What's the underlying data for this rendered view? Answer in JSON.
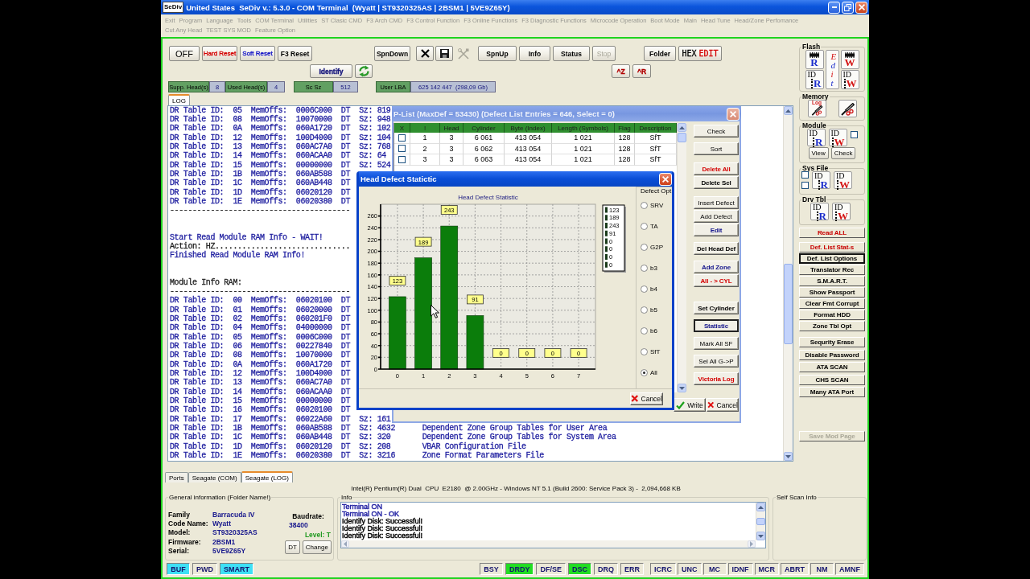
{
  "window": {
    "app_icon_text": "SeDiv",
    "title": "United States  SeDiv v.: 5.3.0 - COM Terminal  (Wyatt | ST9320325AS | 2BSM1 | 5VE9Z65Y)"
  },
  "menu": [
    [
      {
        "label": "Exit",
        "disabled": true
      },
      {
        "label": "Program",
        "disabled": true
      },
      {
        "label": "Language",
        "disabled": true
      },
      {
        "label": "Tools",
        "disabled": true
      },
      {
        "label": "COM Terminal",
        "disabled": true
      },
      {
        "label": "Utilities",
        "disabled": true
      },
      {
        "label": "ST Clasic CMD",
        "disabled": true
      },
      {
        "label": "F3 Arch CMD",
        "disabled": true
      },
      {
        "label": "F3 Control Function",
        "disabled": true
      },
      {
        "label": "F3 Online Functions",
        "disabled": true
      },
      {
        "label": "F3 Diagnostic Functions",
        "disabled": true
      },
      {
        "label": "Microcode Operation",
        "disabled": true
      },
      {
        "label": "Boot Mode",
        "disabled": true
      },
      {
        "label": "Main",
        "disabled": true
      },
      {
        "label": "Head Tune",
        "disabled": true
      },
      {
        "label": "Head/Zone Perfomance",
        "disabled": true
      }
    ],
    [
      {
        "label": "Cut Any Head",
        "disabled": true
      },
      {
        "label": "TEST SYS MOD",
        "disabled": true
      },
      {
        "label": "Feature Option",
        "disabled": true
      }
    ]
  ],
  "toolbar": {
    "row1": [
      [
        {
          "kind": "text",
          "label": "OFF",
          "bold": false,
          "disabled": false
        },
        {
          "kind": "text",
          "label": "Hard Reset",
          "color": "#d40000",
          "bold": false,
          "disabled": false
        },
        {
          "kind": "text",
          "label": "Soft Reset",
          "color": "#1818c8",
          "bold": false,
          "disabled": false
        },
        {
          "kind": "text",
          "label": "F3 Reset",
          "bold": true,
          "disabled": false
        }
      ],
      [
        {
          "kind": "text",
          "label": "SpnDown",
          "bold": true,
          "disabled": false
        }
      ],
      [
        {
          "kind": "icon",
          "disabled": false
        },
        {
          "kind": "icon",
          "disabled": false
        },
        {
          "kind": "icon",
          "disabled": true
        }
      ],
      [
        {
          "kind": "text",
          "label": "SpnUp",
          "bold": true,
          "disabled": false
        },
        {
          "kind": "text",
          "label": "Info",
          "bold": true,
          "disabled": false
        },
        {
          "kind": "text",
          "label": "Status",
          "bold": true,
          "disabled": false
        },
        {
          "kind": "text",
          "label": "Stop",
          "bold": false,
          "disabled": true
        }
      ],
      [
        {
          "kind": "text",
          "label": "Folder",
          "bold": true,
          "disabled": false
        },
        {
          "kind": "split",
          "parts": [
            {
              "text": "HEX",
              "color": "#000000"
            },
            {
              "text": "EDIT",
              "color": "#d40000"
            }
          ],
          "disabled": false
        }
      ]
    ],
    "row2": [
      [
        {
          "kind": "text",
          "label": "Identify",
          "bold": true,
          "color": "#12127a",
          "disabled": false
        },
        {
          "kind": "icon",
          "disabled": false
        }
      ],
      [
        {
          "kind": "text",
          "label": "^Z",
          "bold": true,
          "color": "#b00000",
          "disabled": false
        },
        {
          "kind": "text",
          "label": "^R",
          "bold": true,
          "color": "#b00000",
          "disabled": false
        }
      ]
    ],
    "fields": [
      [
        {
          "label": "Supp. Head(s)",
          "value": "8"
        },
        {
          "label": "Used Head(s)",
          "value": "4"
        }
      ],
      [
        {
          "label": "Sc Sz",
          "value": "512"
        }
      ],
      [
        {
          "label": "User LBA",
          "value": "625 142 447  (298,09 Gb)"
        }
      ]
    ]
  },
  "log_tabs": [
    {
      "label": "LOG",
      "selected": true
    }
  ],
  "log": {
    "blocks": [
      [
        {
          "text": "DR Table ID:  05  MemOffs:  0006C000  DT  Sz: 819",
          "color": "#2020a0"
        },
        {
          "text": "DR Table ID:  08  MemOffs:  10070000  DT  Sz: 948",
          "color": "#2020a0"
        },
        {
          "text": "DR Table ID:  0A  MemOffs:  060A1720  DT  Sz: 102",
          "color": "#2020a0"
        },
        {
          "text": "DR Table ID:  12  MemOffs:  100D4000  DT  Sz: 104",
          "color": "#2020a0"
        },
        {
          "text": "DR Table ID:  13  MemOffs:  060AC7A0  DT  Sz: 768",
          "color": "#2020a0"
        },
        {
          "text": "DR Table ID:  14  MemOffs:  060ACAA0  DT  Sz: 64",
          "color": "#2020a0"
        },
        {
          "text": "DR Table ID:  15  MemOffs:  00000000  DT  Sz: 524",
          "color": "#2020a0"
        },
        {
          "text": "DR Table ID:  1B  MemOffs:  060AB588  DT",
          "color": "#2020a0"
        },
        {
          "text": "DR Table ID:  1C  MemOffs:  060AB448  DT",
          "color": "#2020a0"
        },
        {
          "text": "DR Table ID:  1D  MemOffs:  06020120  DT",
          "color": "#2020a0"
        },
        {
          "text": "DR Table ID:  1E  MemOffs:  06020380  DT",
          "color": "#2020a0"
        },
        {
          "text": "----------------------------------------",
          "color": "#202020"
        }
      ],
      [
        {
          "text": "Start Read Module RAM Info - WAIT!",
          "color": "#2020a0"
        },
        {
          "text": "Action: HZ..............................",
          "color": "#202020"
        },
        {
          "text": "Finished Read Module RAM Info!",
          "color": "#2020a0"
        }
      ],
      [
        {
          "text": "Module Info RAM:",
          "color": "#202020"
        },
        {
          "text": "----------------------------------------",
          "color": "#202020"
        },
        {
          "text": "DR Table ID:  00  MemOffs:  06020100  DT",
          "color": "#2020a0"
        },
        {
          "text": "DR Table ID:  01  MemOffs:  06020000  DT",
          "color": "#2020a0"
        },
        {
          "text": "DR Table ID:  02  MemOffs:  060201F0  DT",
          "color": "#2020a0"
        },
        {
          "text": "DR Table ID:  04  MemOffs:  04000000  DT",
          "color": "#2020a0"
        },
        {
          "text": "DR Table ID:  05  MemOffs:  0006C000  DT",
          "color": "#2020a0"
        },
        {
          "text": "DR Table ID:  06  MemOffs:  00227840  DT",
          "color": "#2020a0"
        },
        {
          "text": "DR Table ID:  08  MemOffs:  10070000  DT",
          "color": "#2020a0"
        },
        {
          "text": "DR Table ID:  0A  MemOffs:  060A1720  DT",
          "color": "#2020a0"
        },
        {
          "text": "DR Table ID:  12  MemOffs:  100D4000  DT",
          "color": "#2020a0"
        },
        {
          "text": "DR Table ID:  13  MemOffs:  060AC7A0  DT",
          "color": "#2020a0"
        },
        {
          "text": "DR Table ID:  14  MemOffs:  060ACAA0  DT",
          "color": "#2020a0"
        },
        {
          "text": "DR Table ID:  15  MemOffs:  00000000  DT",
          "color": "#2020a0"
        },
        {
          "text": "DR Table ID:  16  MemOffs:  06020100  DT",
          "color": "#2020a0"
        },
        {
          "text": "DR Table ID:  17  MemOffs:  06022A60  DT  Sz: 161",
          "color": "#2020a0"
        },
        {
          "text": "DR Table ID:  1B  MemOffs:  060AB588  DT  Sz: 4632      Dependent Zone Group Tables for User Area",
          "color": "#2020a0"
        },
        {
          "text": "DR Table ID:  1C  MemOffs:  060AB448  DT  Sz: 320       Dependent Zone Group Tables for System Area",
          "color": "#2020a0"
        },
        {
          "text": "DR Table ID:  1D  MemOffs:  06020120  DT  Sz: 208       VBAR Configuration File",
          "color": "#2020a0"
        },
        {
          "text": "DR Table ID:  1E  MemOffs:  06020380  DT  Sz: 3216      Zone Format Parameters File",
          "color": "#2020a0"
        }
      ]
    ]
  },
  "plist": {
    "title": "P-List (MaxDef = 53430) (Defect List Entries = 646, Select = 0)",
    "check_column": "X",
    "columns": [
      "!",
      "Head",
      "Cylinder",
      "Byte (Index)",
      "Length (Symbols)",
      "Flag",
      "Description"
    ],
    "rows": [
      {
        "checked": false,
        "cells": [
          "1",
          "3",
          "6 061",
          "413 054",
          "1 021",
          "128",
          "SfT"
        ]
      },
      {
        "checked": false,
        "cells": [
          "2",
          "3",
          "6 062",
          "413 054",
          "1 021",
          "128",
          "SfT"
        ]
      },
      {
        "checked": false,
        "cells": [
          "3",
          "3",
          "6 063",
          "413 054",
          "1 021",
          "128",
          "SfT"
        ]
      }
    ],
    "buttons": [
      [
        {
          "label": "Check",
          "bold": false,
          "selected": false
        },
        {
          "label": "Sort",
          "bold": false,
          "selected": false
        }
      ],
      [
        {
          "label": "Delete All",
          "bold": true,
          "color": "#d40000",
          "selected": false
        },
        {
          "label": "Delete Sel",
          "bold": true,
          "selected": false
        }
      ],
      [
        {
          "label": "Insert Defect",
          "bold": false,
          "selected": false
        },
        {
          "label": "Add Defect",
          "bold": false,
          "selected": false
        },
        {
          "label": "Edit",
          "bold": true,
          "color": "#14148c",
          "selected": false
        }
      ],
      [
        {
          "label": "Del Head Def",
          "bold": true,
          "selected": false
        }
      ],
      [
        {
          "label": "Add Zone",
          "bold": true,
          "color": "#14148c",
          "selected": false
        },
        {
          "label": "All - > CYL",
          "bold": true,
          "color": "#d40000",
          "selected": false
        }
      ],
      [
        {
          "label": "Set Cylinder",
          "bold": true,
          "selected": false
        },
        {
          "label": "Statistic",
          "bold": true,
          "color": "#14148c",
          "selected": true
        },
        {
          "label": "Mark All SF",
          "bold": false,
          "selected": false
        },
        {
          "label": "Sel All G->P",
          "bold": false,
          "selected": false
        },
        {
          "label": "Victoria Log",
          "bold": true,
          "color": "#d40000",
          "selected": false
        }
      ]
    ],
    "write": "Write",
    "cancel": "Cancel"
  },
  "stat_dialog": {
    "title": "Head Defect Statictic",
    "chart_data": [
      {
        "type": "bar",
        "title": "Head Defect Statistic",
        "categories": [
          "0",
          "1",
          "2",
          "3",
          "4",
          "5",
          "6",
          "7"
        ],
        "values": [
          123,
          189,
          243,
          91,
          0,
          0,
          0,
          0
        ],
        "color": "#0b7d0b",
        "ylim": [
          0,
          280
        ],
        "yticks": [
          0,
          20,
          40,
          60,
          80,
          100,
          120,
          140,
          160,
          180,
          200,
          220,
          240,
          260
        ],
        "data_labels": true,
        "grid": true
      }
    ],
    "value_list": [
      "123",
      "189",
      "243",
      "91",
      "0",
      "0",
      "0",
      "0"
    ],
    "options": {
      "title": "Defect Opt",
      "items": [
        {
          "label": "SRV",
          "selected": false
        },
        {
          "label": "TA",
          "selected": false
        },
        {
          "label": "G2P",
          "selected": false
        },
        {
          "label": "b3",
          "selected": false
        },
        {
          "label": "b4",
          "selected": false
        },
        {
          "label": "b5",
          "selected": false
        },
        {
          "label": "b6",
          "selected": false
        },
        {
          "label": "SfT",
          "selected": false
        },
        {
          "label": "All",
          "selected": true
        }
      ]
    },
    "cancel": "Cancel"
  },
  "side_panel": {
    "flash": {
      "title": "Flash",
      "chip_buttons": [
        {
          "kind": "read",
          "letter": "R"
        },
        {
          "kind": "write",
          "letter": "W"
        }
      ],
      "edit_letters": "Edit",
      "id_buttons": [
        {
          "kind": "read",
          "label": "ID",
          "letter": "R"
        },
        {
          "kind": "write",
          "label": "ID",
          "letter": "W"
        }
      ]
    },
    "memory": {
      "title": "Memory",
      "log_label": "Log"
    },
    "module": {
      "title": "Module",
      "id_buttons": [
        {
          "kind": "read",
          "label": "ID",
          "letter": "R"
        },
        {
          "kind": "write",
          "label": "ID",
          "letter": "W"
        }
      ],
      "checked": false,
      "buttons": [
        "View",
        "Check"
      ]
    },
    "sys_file": {
      "title": "Sys File",
      "checks": [
        {
          "checked": false
        },
        {
          "checked": false
        }
      ],
      "id_buttons": [
        {
          "kind": "read",
          "label": "ID",
          "letter": "R"
        },
        {
          "kind": "write",
          "label": "ID",
          "letter": "W"
        }
      ]
    },
    "drv_tbl": {
      "title": "Drv Tbl",
      "id_buttons": [
        {
          "kind": "read",
          "label": "ID",
          "letter": "R"
        },
        {
          "kind": "write",
          "label": "ID",
          "letter": "W"
        }
      ]
    },
    "buttons": [
      [
        {
          "label": "Read ALL",
          "color": "#c80000",
          "selected": false,
          "disabled": false
        }
      ],
      [
        {
          "label": "Def. List Stat-s",
          "color": "#c80000",
          "selected": false,
          "disabled": false
        },
        {
          "label": "Def. List Options",
          "selected": true,
          "disabled": false
        },
        {
          "label": "Translator Rec",
          "selected": false,
          "disabled": false
        },
        {
          "label": "S.M.A.R.T.",
          "selected": false,
          "disabled": false
        },
        {
          "label": "Show Passport",
          "selected": false,
          "disabled": false
        },
        {
          "label": "Clear Fmt Corrupt",
          "selected": false,
          "disabled": false
        },
        {
          "label": "Format HDD",
          "selected": false,
          "disabled": false
        },
        {
          "label": "Zone Tbl Opt",
          "selected": false,
          "disabled": false
        }
      ],
      [
        {
          "label": "Sequrity Erase",
          "selected": false,
          "disabled": false
        },
        {
          "label": "Disable Password",
          "selected": false,
          "disabled": false
        },
        {
          "label": "ATA SCAN",
          "selected": false,
          "disabled": false
        },
        {
          "label": "CHS SCAN",
          "selected": false,
          "disabled": false
        },
        {
          "label": "Many ATA Port",
          "selected": false,
          "disabled": false
        }
      ],
      [
        {
          "label": "Save Mod Page",
          "selected": false,
          "disabled": true
        }
      ]
    ]
  },
  "bottom_tabs": [
    {
      "label": "Ports",
      "selected": false
    },
    {
      "label": "Seagate (COM)",
      "selected": false
    },
    {
      "label": "Seagate (LOG)",
      "selected": true
    }
  ],
  "system_info": "Intel(R) Pentium(R) Dual  CPU  E2180  @ 2.00GHz - Windows NT 5.1 (Build 2600: Service Pack 3) -  2,094,668 KB",
  "general_info": {
    "title": "General information (Folder Name!)",
    "fields": [
      {
        "label": "Family",
        "value": "Barracuda IV"
      },
      {
        "label": "Code Name:",
        "value": "Wyatt"
      },
      {
        "label": "Model:",
        "value": "ST9320325AS"
      },
      {
        "label": "Firmware:",
        "value": "2BSM1"
      },
      {
        "label": "Serial:",
        "value": "5VE9Z65Y"
      }
    ],
    "baudrate_label": "Baudrate:",
    "baudrate": "38400",
    "level": "Level: T",
    "buttons": [
      "DT",
      "Change"
    ]
  },
  "info": {
    "title": "Info",
    "lines": [
      {
        "text": "Terminal ON",
        "color": "#1c1ca0"
      },
      {
        "text": "Terminal ON - OK",
        "color": "#1c1ca0"
      },
      {
        "text": "Identify Disk: Successful!",
        "color": "#000000"
      },
      {
        "text": "Identify Disk: Successful!",
        "color": "#000000"
      },
      {
        "text": "Identify Disk: Successful!",
        "color": "#000000"
      }
    ]
  },
  "self_scan": {
    "title": "Self Scan Info"
  },
  "status_bar": {
    "flags": [
      {
        "label": "BUF",
        "on": true
      },
      {
        "label": "PWD",
        "on": false
      },
      {
        "label": "SMART",
        "on": true
      }
    ],
    "registers": [
      {
        "label": "BSY",
        "on": false
      },
      {
        "label": "DRDY",
        "on": true
      },
      {
        "label": "DF/SE",
        "on": false
      },
      {
        "label": "DSC",
        "on": true
      },
      {
        "label": "DRQ",
        "on": false
      },
      {
        "label": "ERR",
        "on": false
      }
    ],
    "errors": [
      {
        "label": "ICRC",
        "on": false
      },
      {
        "label": "UNC",
        "on": false
      },
      {
        "label": "MC",
        "on": false
      },
      {
        "label": "IDNF",
        "on": false
      },
      {
        "label": "MCR",
        "on": false
      },
      {
        "label": "ABRT",
        "on": false
      },
      {
        "label": "NM",
        "on": false
      },
      {
        "label": "AMNF",
        "on": false
      }
    ]
  }
}
